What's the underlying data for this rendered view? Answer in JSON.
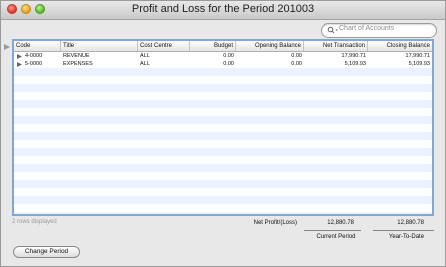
{
  "window": {
    "title": "Profit and Loss for the Period 201003"
  },
  "search": {
    "placeholder": "Chart of Accounts"
  },
  "table": {
    "columns": [
      "Code",
      "Title",
      "Cost Centre",
      "Budget",
      "Opening Balance",
      "Net Transaction",
      "Closing Balance"
    ],
    "rows": [
      {
        "code": "4-0000",
        "title": "REVENUE",
        "cost_centre": "ALL",
        "budget": "0.00",
        "opening_balance": "0.00",
        "net_transaction": "17,990.71",
        "closing_balance": "17,990.71"
      },
      {
        "code": "5-0000",
        "title": "EXPENSES",
        "cost_centre": "ALL",
        "budget": "0.00",
        "opening_balance": "0.00",
        "net_transaction": "5,109.93",
        "closing_balance": "5,109.93"
      }
    ]
  },
  "footer": {
    "rows_displayed": "2 rows displayed",
    "net_label": "Net Profit/(Loss)",
    "current_period_value": "12,880.78",
    "ytd_value": "12,880.78",
    "current_period_caption": "Current Period",
    "ytd_caption": "Year-To-Date"
  },
  "buttons": {
    "change_period": "Change Period"
  }
}
